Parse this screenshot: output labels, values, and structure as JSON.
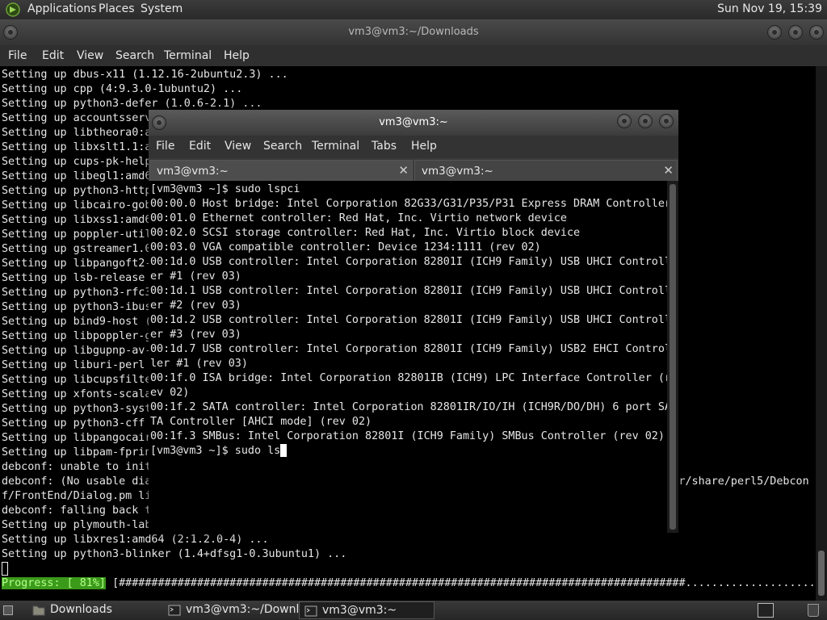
{
  "top_panel": {
    "applications": "Applications",
    "places": "Places",
    "system": "System",
    "clock": "Sun Nov 19, 15:39"
  },
  "back_window": {
    "title": "vm3@vm3:~/Downloads",
    "menu": [
      "File",
      "Edit",
      "View",
      "Search",
      "Terminal",
      "Help"
    ],
    "lines": [
      "Setting up dbus-x11 (1.12.16-2ubuntu2.3) ...",
      "Setting up cpp (4:9.3.0-1ubuntu2) ...",
      "Setting up python3-defer (1.0.6-2.1) ...",
      "Setting up accountsserv",
      "Setting up libtheora0:a",
      "Setting up libxslt1.1:a",
      "Setting up cups-pk-help",
      "Setting up libegl1:amd6",
      "Setting up python3-http",
      "Setting up libcairo-gob",
      "Setting up libxss1:amd6",
      "Setting up poppler-util",
      "Setting up gstreamer1.0",
      "Setting up libpangoft2-",
      "Setting up lsb-release",
      "Setting up python3-rfc3",
      "Setting up python3-ibus",
      "Setting up bind9-host (",
      "Setting up libpoppler-g",
      "Setting up libgupnp-av-",
      "Setting up liburi-perl",
      "Setting up libcupsfilte",
      "Setting up xfonts-scala",
      "Setting up python3-syst",
      "Setting up python3-cff",
      "Setting up libpangocair",
      "Setting up libpam-fprin",
      "debconf: unable to init",
      "debconf: (No usable dia                                                                                 r/share/perl5/Debcon",
      "f/FrontEnd/Dialog.pm li",
      "debconf: falling back t",
      "Setting up plymouth-lab",
      "Setting up libxres1:amd64 (2:1.2.0-4) ...",
      "Setting up python3-blinker (1.4+dfsg1-0.3ubuntu1) ..."
    ],
    "progress_label": "Progress: [ 81%]",
    "progress_value": 81,
    "progress_bar": "[#######################################################################################....................]"
  },
  "front_window": {
    "title": "vm3@vm3:~",
    "menu": [
      "File",
      "Edit",
      "View",
      "Search",
      "Terminal",
      "Tabs",
      "Help"
    ],
    "tabs": [
      {
        "label": "vm3@vm3:~"
      },
      {
        "label": "vm3@vm3:~"
      }
    ],
    "lines": [
      "[vm3@vm3 ~]$ sudo lspci",
      "00:00.0 Host bridge: Intel Corporation 82G33/G31/P35/P31 Express DRAM Controller",
      "00:01.0 Ethernet controller: Red Hat, Inc. Virtio network device",
      "00:02.0 SCSI storage controller: Red Hat, Inc. Virtio block device",
      "00:03.0 VGA compatible controller: Device 1234:1111 (rev 02)",
      "00:1d.0 USB controller: Intel Corporation 82801I (ICH9 Family) USB UHCI Controll",
      "er #1 (rev 03)",
      "00:1d.1 USB controller: Intel Corporation 82801I (ICH9 Family) USB UHCI Controll",
      "er #2 (rev 03)",
      "00:1d.2 USB controller: Intel Corporation 82801I (ICH9 Family) USB UHCI Controll",
      "er #3 (rev 03)",
      "00:1d.7 USB controller: Intel Corporation 82801I (ICH9 Family) USB2 EHCI Control",
      "ler #1 (rev 03)",
      "00:1f.0 ISA bridge: Intel Corporation 82801IB (ICH9) LPC Interface Controller (r",
      "ev 02)",
      "00:1f.2 SATA controller: Intel Corporation 82801IR/IO/IH (ICH9R/DO/DH) 6 port SA",
      "TA Controller [AHCI mode] (rev 02)",
      "00:1f.3 SMBus: Intel Corporation 82801I (ICH9 Family) SMBus Controller (rev 02)"
    ],
    "prompt_line": "[vm3@vm3 ~]$ sudo ls"
  },
  "taskbar": {
    "tasks": [
      {
        "label": "Downloads"
      },
      {
        "label": "vm3@vm3:~/Downl..."
      },
      {
        "label": "vm3@vm3:~"
      }
    ]
  }
}
